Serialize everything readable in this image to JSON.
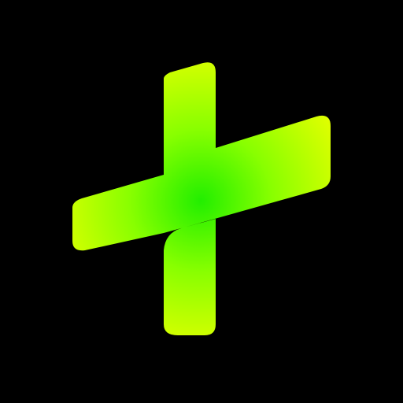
{
  "icon": {
    "name": "plus-icon",
    "colors": {
      "background": "#000000",
      "center": "#22ee00",
      "mid": "#88ff00",
      "edge": "#e6ff00"
    }
  }
}
